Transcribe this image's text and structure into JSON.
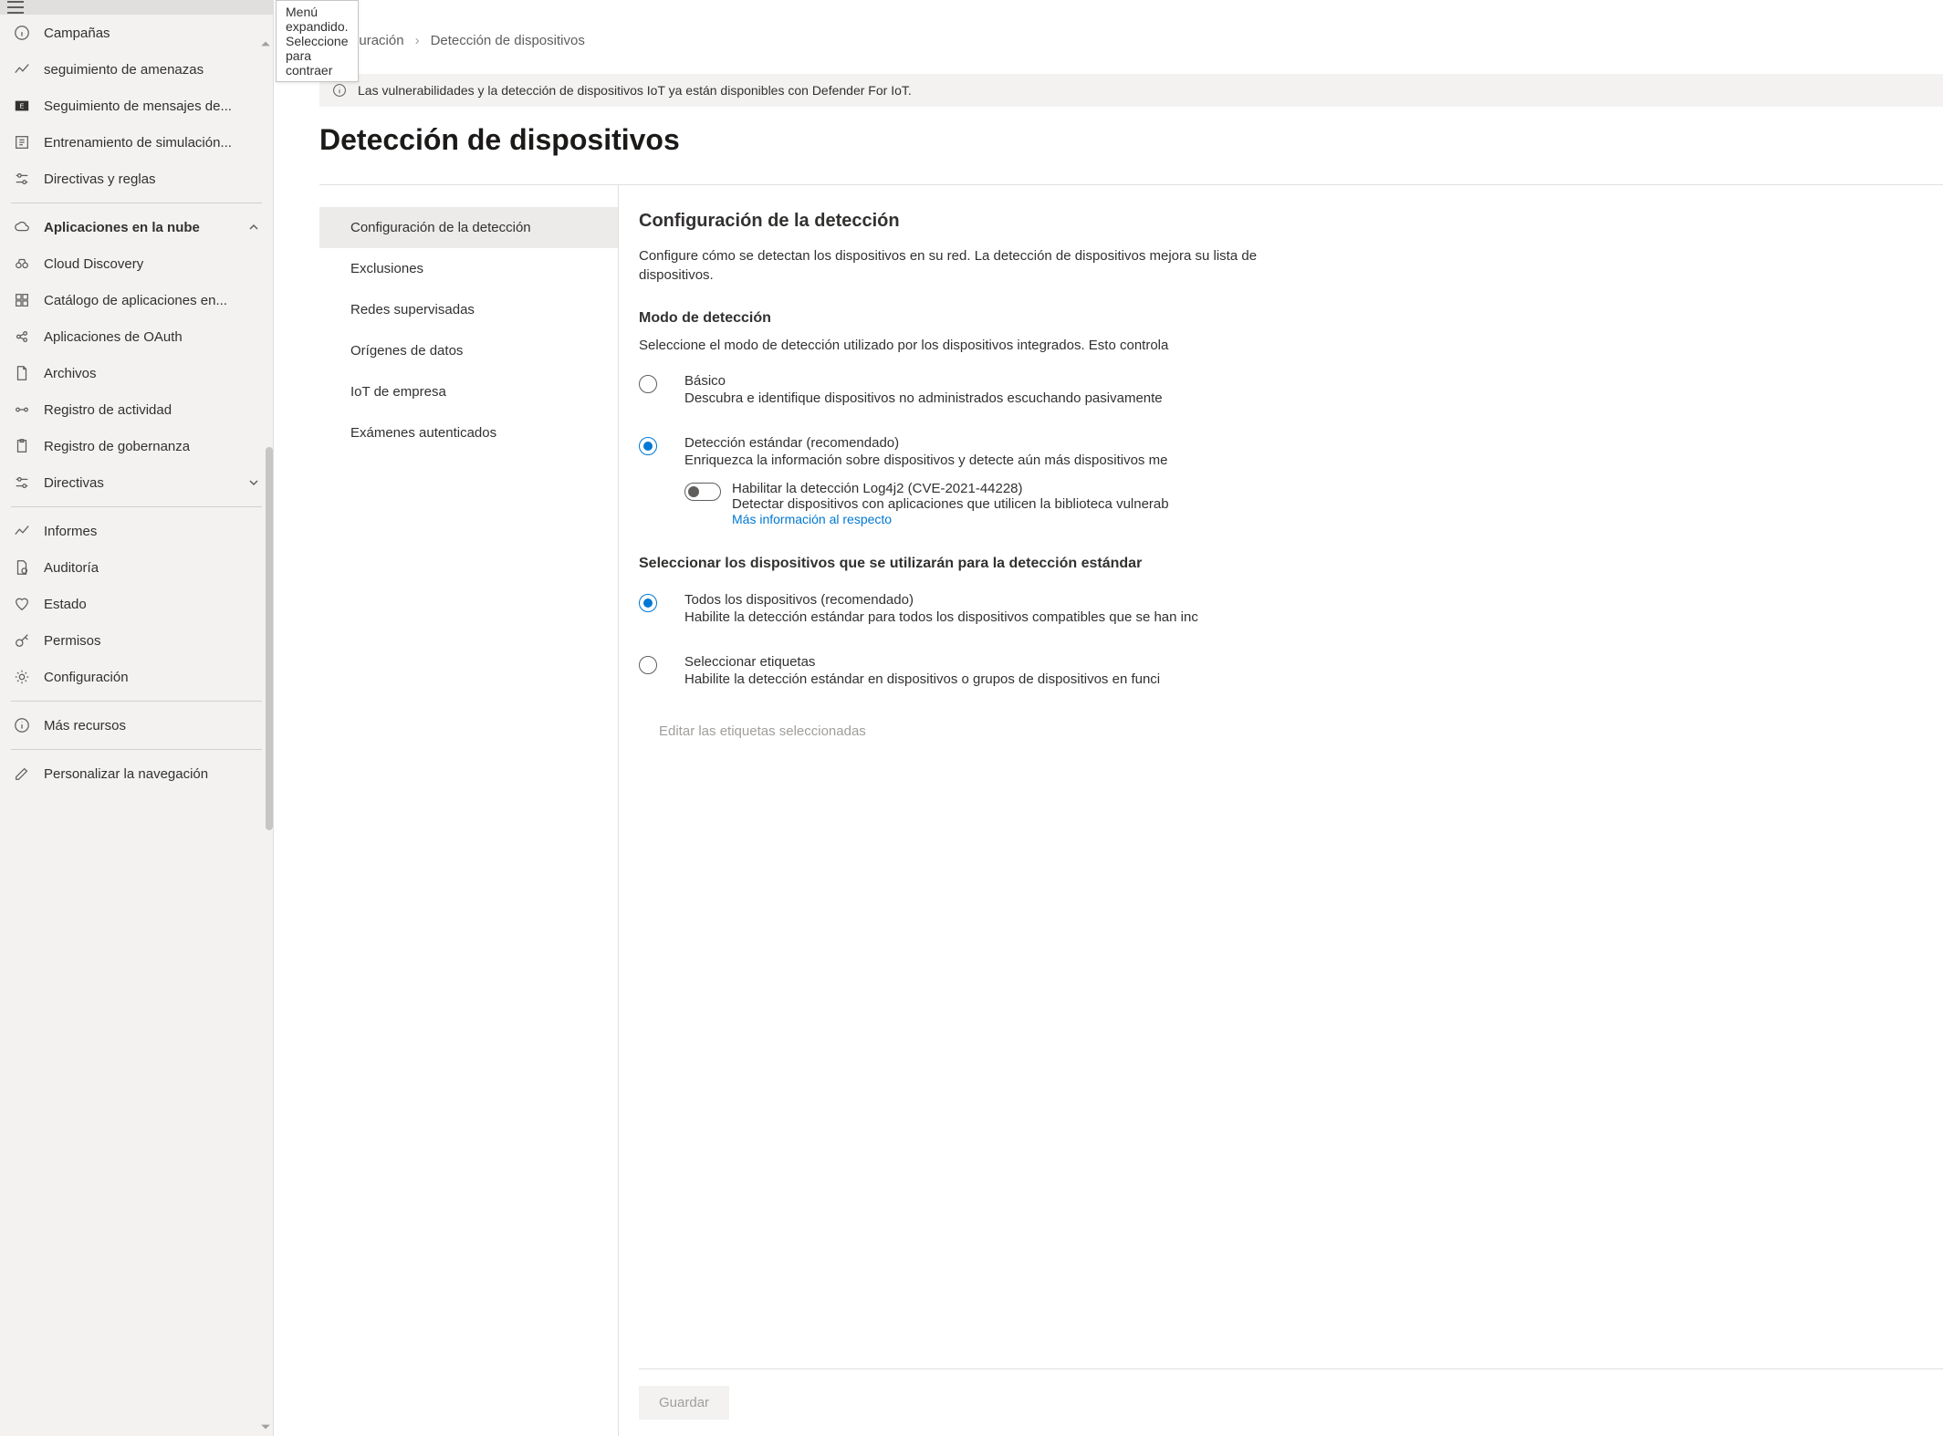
{
  "tooltip": "Menú expandido. Seleccione para contraer",
  "sidebar": {
    "items_top": [
      {
        "label": "Campañas"
      },
      {
        "label": "seguimiento de amenazas"
      },
      {
        "label": "Seguimiento de mensajes de..."
      },
      {
        "label": "Entrenamiento de simulación..."
      },
      {
        "label": "Directivas y reglas"
      }
    ],
    "section": "Aplicaciones en la nube",
    "items_section": [
      {
        "label": "Cloud Discovery"
      },
      {
        "label": "Catálogo de aplicaciones en..."
      },
      {
        "label": "Aplicaciones de OAuth"
      },
      {
        "label": "Archivos"
      },
      {
        "label": "Registro de actividad"
      },
      {
        "label": "Registro de gobernanza"
      },
      {
        "label": "Directivas"
      }
    ],
    "items_bottom": [
      {
        "label": "Informes"
      },
      {
        "label": "Auditoría"
      },
      {
        "label": "Estado"
      },
      {
        "label": "Permisos"
      },
      {
        "label": "Configuración"
      }
    ],
    "items_foot": [
      {
        "label": "Más recursos"
      }
    ],
    "items_last": [
      {
        "label": "Personalizar la navegación"
      }
    ]
  },
  "breadcrumb": {
    "a": "Configuración",
    "b": "Detección de dispositivos"
  },
  "banner": "Las vulnerabilidades y la detección de dispositivos IoT ya están disponibles con Defender For IoT.",
  "page_title": "Detección de dispositivos",
  "subnav": [
    "Configuración de la detección",
    "Exclusiones",
    "Redes supervisadas",
    "Orígenes de datos",
    "IoT de empresa",
    "Exámenes autenticados"
  ],
  "panel": {
    "title": "Configuración de la detección",
    "desc": "Configure cómo se detectan los dispositivos en su red. La detección de dispositivos mejora su lista de dispositivos.",
    "mode_label": "Modo de detección",
    "mode_help": "Seleccione el modo de detección utilizado por los dispositivos integrados. Esto controla",
    "basic": {
      "label": "Básico",
      "desc": "Descubra e identifique dispositivos no administrados escuchando pasivamente"
    },
    "standard": {
      "label": "Detección estándar (recomendado)",
      "desc": "Enriquezca la información sobre dispositivos y detecte aún más dispositivos me"
    },
    "log4j": {
      "label": "Habilitar la detección Log4j2 (CVE-2021-44228)",
      "desc": "Detectar dispositivos con aplicaciones que utilicen la biblioteca vulnerab",
      "link": "Más información al respecto"
    },
    "select_devices_label": "Seleccionar los dispositivos que se utilizarán para la detección estándar",
    "all_devices": {
      "label": "Todos los dispositivos (recomendado)",
      "desc": "Habilite la detección estándar para todos los dispositivos compatibles que se han inc"
    },
    "tags": {
      "label": "Seleccionar etiquetas",
      "desc": "Habilite la detección estándar en dispositivos o grupos de dispositivos en funci"
    },
    "edit_tags": "Editar las etiquetas seleccionadas",
    "save": "Guardar"
  }
}
